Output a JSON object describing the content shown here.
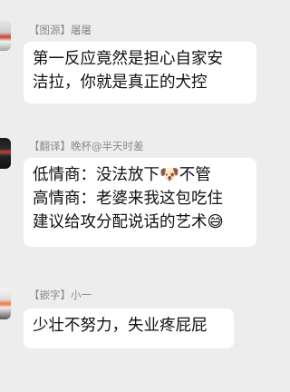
{
  "messages": [
    {
      "name": "【图源】屠屠",
      "lines": [
        "第一反应竟然是担心自家安",
        "洁拉，你就是真正的犬控"
      ]
    },
    {
      "name": "【翻译】晚杯@半天时差",
      "lines": [
        "低情商：没法放下🐶不管",
        "高情商：老婆来我这包吃住",
        "建议给攻分配说话的艺术😅"
      ]
    },
    {
      "name": "【嵌字】小一",
      "lines": [
        "少壮不努力，失业疼屁屁"
      ]
    }
  ],
  "colors": {
    "background": "#ededed",
    "bubble": "#ffffff",
    "name_text": "#8a8a8a"
  }
}
